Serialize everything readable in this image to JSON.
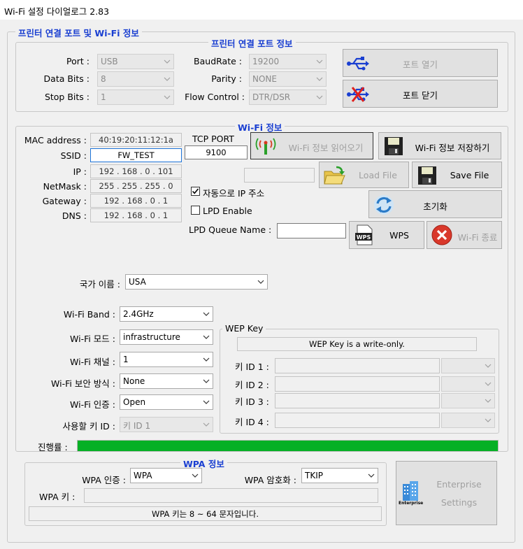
{
  "window": {
    "title": "Wi-Fi 설정 다이얼로그 2.83"
  },
  "groups": {
    "main": "프린터 연결 포트 및 Wi-Fi 정보",
    "port": "프린터 연결 포트 정보",
    "wifi": "Wi-Fi 정보",
    "wep": "WEP Key",
    "wpa": "WPA 정보"
  },
  "port": {
    "port_label": "Port :",
    "port_value": "USB",
    "databits_label": "Data Bits :",
    "databits_value": "8",
    "stopbits_label": "Stop Bits :",
    "stopbits_value": "1",
    "baud_label": "BaudRate :",
    "baud_value": "19200",
    "parity_label": "Parity :",
    "parity_value": "NONE",
    "flow_label": "Flow Control :",
    "flow_value": "DTR/DSR",
    "open_button": "포트 열기",
    "close_button": "포트 닫기"
  },
  "wifi": {
    "mac_label": "MAC address :",
    "mac_value": "40:19:20:11:12:1a",
    "ssid_label": "SSID :",
    "ssid_value": "FW_TEST",
    "ip_label": "IP :",
    "ip_value": "192 . 168 .  0  . 101",
    "netmask_label": "NetMask :",
    "netmask_value": "255 . 255 . 255 .  0",
    "gateway_label": "Gateway :",
    "gateway_value": "192 . 168 .  0  .  1",
    "dns_label": "DNS :",
    "dns_value": "192 . 168 .  0  .  1",
    "tcp_label": "TCP PORT",
    "tcp_value": "9100",
    "read_button": "Wi-Fi 정보 읽어오기",
    "save_button": "Wi-Fi 정보 저장하기",
    "load_file_button": "Load File",
    "save_file_button": "Save File",
    "auto_ip_label": "자동으로 IP 주소",
    "auto_ip_checked": true,
    "lpd_label": "LPD Enable",
    "lpd_checked": false,
    "lpd_queue_label": "LPD Queue Name :",
    "init_button": "초기화",
    "wps_button": "WPS",
    "wifi_exit_button": "Wi-Fi 종료",
    "country_label": "국가 이름 :",
    "country_value": "USA",
    "band_label": "Wi-Fi Band :",
    "band_value": "2.4GHz",
    "mode_label": "Wi-Fi 모드 :",
    "mode_value": "infrastructure",
    "channel_label": "Wi-Fi 채널 :",
    "channel_value": "1",
    "security_label": "Wi-Fi 보안 방식 :",
    "security_value": "None",
    "auth_label": "Wi-Fi 인증 :",
    "auth_value": "Open",
    "keyid_label": "사용할 키 ID :",
    "keyid_value": "키 ID 1"
  },
  "wep": {
    "notice": "WEP Key is a write-only.",
    "key1": "키 ID 1 :",
    "key2": "키 ID 2 :",
    "key3": "키 ID 3 :",
    "key4": "키 ID 4 :"
  },
  "progress": {
    "label": "진행률 :",
    "fraction": 1.0
  },
  "wpa": {
    "auth_label": "WPA 인증 :",
    "auth_value": "WPA",
    "enc_label": "WPA 암호화 :",
    "enc_value": "TKIP",
    "key_label": "WPA 키 :",
    "notice": "WPA 키는 8 ~ 64 문자입니다."
  },
  "enterprise": {
    "line1": "Enterprise",
    "line2": "Settings",
    "icon_text": "Enterprise"
  },
  "colors": {
    "group_title": "#1a3fd1",
    "progress": "#06b025",
    "focus": "#1e74d8",
    "exit_red": "#d9382b"
  }
}
